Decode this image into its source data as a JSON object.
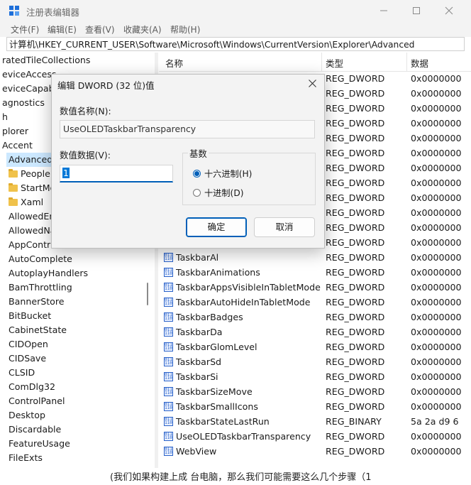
{
  "window": {
    "title": "注册表编辑器"
  },
  "menu": [
    "文件(F)",
    "编辑(E)",
    "查看(V)",
    "收藏夹(A)",
    "帮助(H)"
  ],
  "address": "计算机\\HKEY_CURRENT_USER\\Software\\Microsoft\\Windows\\CurrentVersion\\Explorer\\Advanced",
  "tree": [
    {
      "label": "ratedTileCollections",
      "folder": false
    },
    {
      "label": "eviceAccess",
      "folder": false
    },
    {
      "label": "eviceCapab",
      "folder": false
    },
    {
      "label": "agnostics",
      "folder": false
    },
    {
      "label": "h",
      "folder": false
    },
    {
      "label": "plorer",
      "folder": false
    },
    {
      "label": "Accent",
      "folder": false
    },
    {
      "label": "Advanced",
      "folder": false,
      "selected": true
    },
    {
      "label": "People",
      "folder": true
    },
    {
      "label": "StartMo",
      "folder": true
    },
    {
      "label": "Xaml",
      "folder": true
    },
    {
      "label": "AllowedEn",
      "folder": false
    },
    {
      "label": "AllowedNa",
      "folder": false
    },
    {
      "label": "AppContra",
      "folder": false
    },
    {
      "label": "AutoComplete",
      "folder": false
    },
    {
      "label": "AutoplayHandlers",
      "folder": false
    },
    {
      "label": "BamThrottling",
      "folder": false
    },
    {
      "label": "BannerStore",
      "folder": false
    },
    {
      "label": "BitBucket",
      "folder": false
    },
    {
      "label": "CabinetState",
      "folder": false
    },
    {
      "label": "CIDOpen",
      "folder": false
    },
    {
      "label": "CIDSave",
      "folder": false
    },
    {
      "label": "CLSID",
      "folder": false
    },
    {
      "label": "ComDlg32",
      "folder": false
    },
    {
      "label": "ControlPanel",
      "folder": false
    },
    {
      "label": "Desktop",
      "folder": false
    },
    {
      "label": "Discardable",
      "folder": false
    },
    {
      "label": "FeatureUsage",
      "folder": false
    },
    {
      "label": "FileExts",
      "folder": false
    }
  ],
  "columns": {
    "name": "名称",
    "type": "类型",
    "data": "数据"
  },
  "rows": [
    {
      "name": "",
      "type": "REG_DWORD",
      "data": "0x0000000"
    },
    {
      "name": "",
      "type": "REG_DWORD",
      "data": "0x0000000"
    },
    {
      "name": "",
      "type": "REG_DWORD",
      "data": "0x0000000"
    },
    {
      "name": "",
      "type": "REG_DWORD",
      "data": "0x0000000"
    },
    {
      "name": "",
      "type": "REG_DWORD",
      "data": "0x0000000"
    },
    {
      "name": "",
      "type": "REG_DWORD",
      "data": "0x0000000"
    },
    {
      "name": "",
      "type": "REG_DWORD",
      "data": "0x0000000"
    },
    {
      "name": "",
      "type": "REG_DWORD",
      "data": "0x0000000"
    },
    {
      "name": "",
      "type": "REG_DWORD",
      "data": "0x0000000"
    },
    {
      "name": "",
      "type": "REG_DWORD",
      "data": "0x0000000"
    },
    {
      "name": "",
      "type": "REG_DWORD",
      "data": "0x0000000"
    },
    {
      "name": "",
      "type": "REG_DWORD",
      "data": "0x0000000"
    },
    {
      "name": "TaskbarAl",
      "type": "REG_DWORD",
      "data": "0x0000000"
    },
    {
      "name": "TaskbarAnimations",
      "type": "REG_DWORD",
      "data": "0x0000000"
    },
    {
      "name": "TaskbarAppsVisibleInTabletMode",
      "type": "REG_DWORD",
      "data": "0x0000000"
    },
    {
      "name": "TaskbarAutoHideInTabletMode",
      "type": "REG_DWORD",
      "data": "0x0000000"
    },
    {
      "name": "TaskbarBadges",
      "type": "REG_DWORD",
      "data": "0x0000000"
    },
    {
      "name": "TaskbarDa",
      "type": "REG_DWORD",
      "data": "0x0000000"
    },
    {
      "name": "TaskbarGlomLevel",
      "type": "REG_DWORD",
      "data": "0x0000000"
    },
    {
      "name": "TaskbarSd",
      "type": "REG_DWORD",
      "data": "0x0000000"
    },
    {
      "name": "TaskbarSi",
      "type": "REG_DWORD",
      "data": "0x0000000"
    },
    {
      "name": "TaskbarSizeMove",
      "type": "REG_DWORD",
      "data": "0x0000000"
    },
    {
      "name": "TaskbarSmallIcons",
      "type": "REG_DWORD",
      "data": "0x0000000"
    },
    {
      "name": "TaskbarStateLastRun",
      "type": "REG_BINARY",
      "data": "5a 2a d9 6"
    },
    {
      "name": "UseOLEDTaskbarTransparency",
      "type": "REG_DWORD",
      "data": "0x0000000"
    },
    {
      "name": "WebView",
      "type": "REG_DWORD",
      "data": "0x0000000"
    }
  ],
  "dialog": {
    "title": "编辑 DWORD (32 位)值",
    "value_name_label": "数值名称(N):",
    "value_name": "UseOLEDTaskbarTransparency",
    "value_data_label": "数值数据(V):",
    "value_data": "1",
    "base_label": "基数",
    "radio_hex": "十六进制(H)",
    "radio_dec": "十进制(D)",
    "base_selected": "hex",
    "ok": "确定",
    "cancel": "取消"
  },
  "background_text": {
    "bottom": "(我们如果构建上成  台电脑，那么我们可能需要这么几个步骤（1"
  },
  "colors": {
    "accent": "#005fb8",
    "selection": "#cce8ff",
    "folder": "#f0c24b"
  }
}
